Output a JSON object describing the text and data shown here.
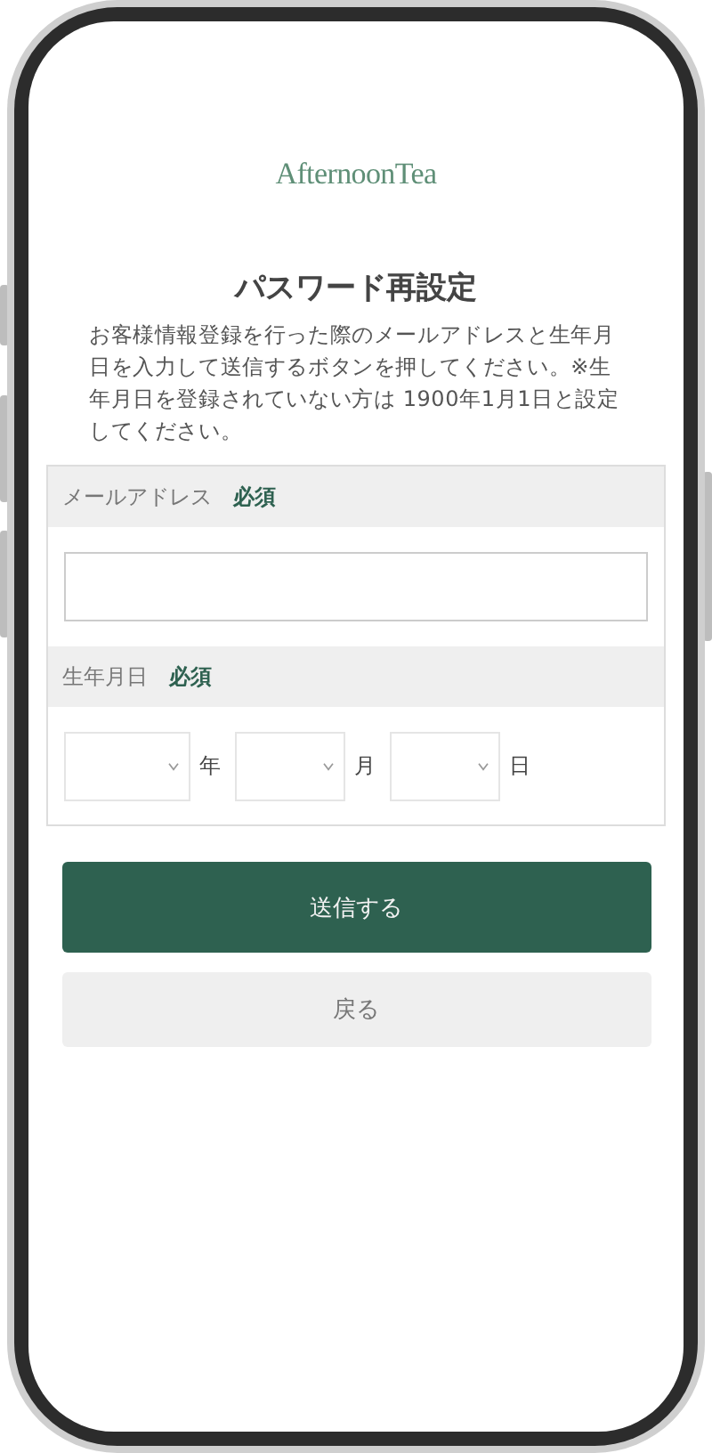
{
  "logo": "AfternoonTea",
  "title": "パスワード再設定",
  "description": "お客様情報登録を行った際のメールアドレスと生年月日を入力して送信するボタンを押してください。※生年月日を登録されていない方は 1900年1月1日と設定してください。",
  "fields": [
    {
      "kind": "text",
      "label": "メールアドレス",
      "badge": "必須"
    },
    {
      "kind": "date",
      "label": "生年月日",
      "badge": "必須",
      "parts": [
        {
          "unit": "年"
        },
        {
          "unit": "月"
        },
        {
          "unit": "日"
        }
      ]
    }
  ],
  "buttons": [
    {
      "kind": "primary",
      "label": "送信する"
    },
    {
      "kind": "secondary",
      "label": "戻る"
    }
  ]
}
